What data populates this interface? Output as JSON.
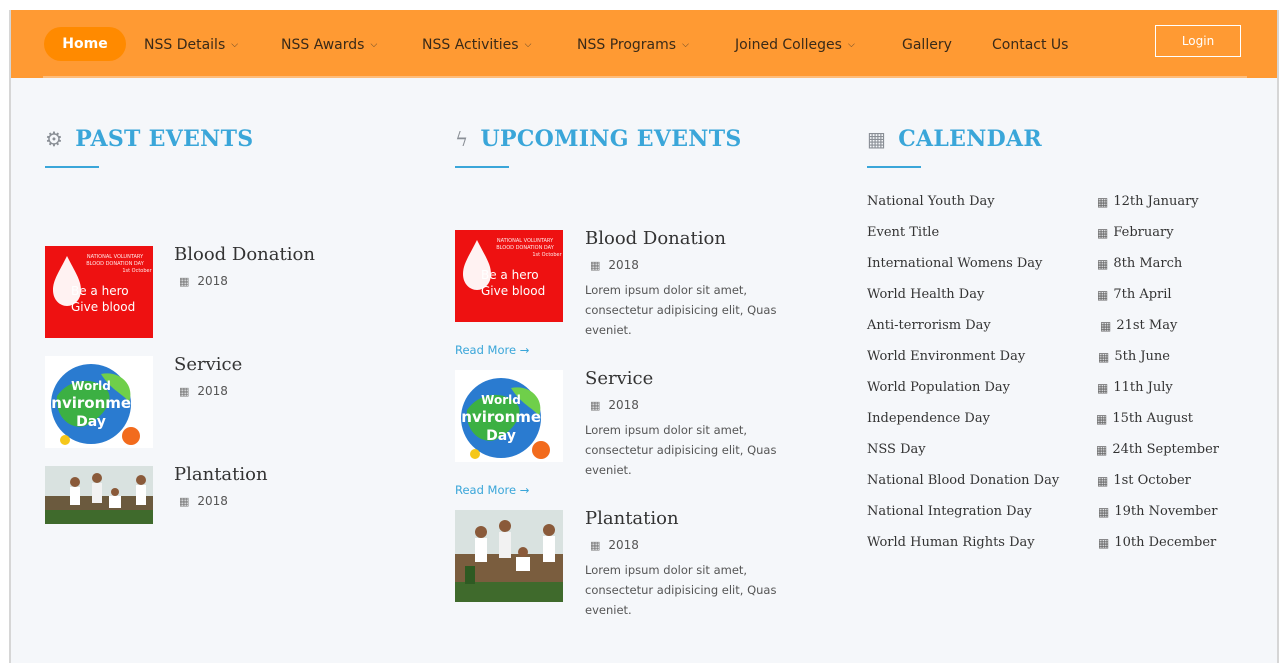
{
  "nav": {
    "home": "Home",
    "items": [
      {
        "label": "NSS Details",
        "chevron": true
      },
      {
        "label": "NSS Awards",
        "chevron": true
      },
      {
        "label": "NSS Activities",
        "chevron": true
      },
      {
        "label": "NSS Programs",
        "chevron": true
      },
      {
        "label": "Joined Colleges",
        "chevron": true
      },
      {
        "label": "Gallery",
        "chevron": false
      },
      {
        "label": "Contact Us",
        "chevron": false
      }
    ],
    "login": "Login"
  },
  "past_events": {
    "heading": "PAST EVENTS",
    "items": [
      {
        "title": "Blood Donation",
        "year": "2018"
      },
      {
        "title": "Service",
        "year": "2018"
      },
      {
        "title": "Plantation",
        "year": "2018"
      }
    ]
  },
  "upcoming_events": {
    "heading": "UPCOMING EVENTS",
    "read_more": "Read More →",
    "items": [
      {
        "title": "Blood Donation",
        "year": "2018",
        "desc": "Lorem ipsum dolor sit amet, consectetur adipisicing elit, Quas eveniet."
      },
      {
        "title": "Service",
        "year": "2018",
        "desc": "Lorem ipsum dolor sit amet, consectetur adipisicing elit, Quas eveniet."
      },
      {
        "title": "Plantation",
        "year": "2018",
        "desc": "Lorem ipsum dolor sit amet, consectetur adipisicing elit, Quas eveniet."
      }
    ]
  },
  "calendar": {
    "heading": "CALENDAR",
    "rows": [
      {
        "name": "National Youth Day",
        "date": "12th January"
      },
      {
        "name": "Event Title",
        "date": "February"
      },
      {
        "name": "International Womens Day",
        "date": "8th March"
      },
      {
        "name": "World Health Day",
        "date": "7th April"
      },
      {
        "name": "Anti-terrorism Day",
        "date": "21st May"
      },
      {
        "name": "World Environment Day",
        "date": "5th June"
      },
      {
        "name": "World Population Day",
        "date": "11th July"
      },
      {
        "name": "Independence Day",
        "date": "15th August"
      },
      {
        "name": "NSS Day",
        "date": "24th September"
      },
      {
        "name": "National Blood Donation Day",
        "date": "1st October"
      },
      {
        "name": "National Integration Day",
        "date": "19th November"
      },
      {
        "name": "World Human Rights Day",
        "date": "10th December"
      }
    ]
  },
  "images": {
    "blood": {
      "line1": "NATIONAL VOLUNTARY",
      "line2": "BLOOD DONATION DAY",
      "line3": "1st October",
      "slogan1": "Be a hero",
      "slogan2": "Give blood"
    },
    "env": {
      "line1": "World",
      "line2": "Environment",
      "line3": "Day"
    }
  },
  "colors": {
    "nav_bg": "#ff9a33",
    "home_bg": "#ff8a00",
    "accent": "#3aa6d9"
  }
}
